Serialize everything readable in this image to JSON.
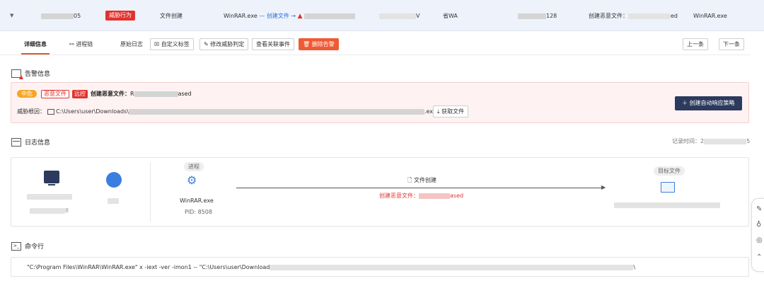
{
  "row": {
    "id_suffix": "05",
    "tag": "威胁行为",
    "event_type": "文件创建",
    "process": "WinRAR.exe",
    "flow_link": "— 创建文件 →",
    "v_suffix": "V",
    "province": "省WA",
    "ip_suffix": "128",
    "created_label": "创建恶意文件：",
    "created_suffix": "ed",
    "process2": "WinRAR.exe"
  },
  "tabs": [
    {
      "label": "详细信息"
    },
    {
      "label": "进程链"
    },
    {
      "label": "原始日志"
    }
  ],
  "buttons": {
    "custom_tag": "自定义标签",
    "modify": "修改威胁判定",
    "related": "查看关联事件",
    "delete": "删除告警",
    "prev": "上一条",
    "next": "下一条"
  },
  "alert_section": {
    "title": "告警信息",
    "level": "中危",
    "type": "恶意文件",
    "remote": "远控",
    "title_prefix": "创建恶意文件：",
    "title_start": "R",
    "title_end": "ased",
    "cause_label": "威胁根因：",
    "path_start": "C:\\Users\\user\\Downloads\\",
    "path_ext": ".exe",
    "fetch": "获取文件",
    "auto_response": "创建自动响应策略"
  },
  "log_section": {
    "title": "日志信息",
    "record_time_label": "记录时间：",
    "record_time_start": "2",
    "record_time_end": "5",
    "host_ip_suffix": "8",
    "process_chip": "进程",
    "process_name": "WinRAR.exe",
    "pid": "PID: 8508",
    "action": "文件创建",
    "action_detail_prefix": "创建恶意文件：",
    "action_detail_end": "ased",
    "target_chip": "目标文件"
  },
  "cmd_section": {
    "title": "命令行",
    "cmd_start": "\"C:\\Program Files\\WinRAR\\WinRAR.exe\" x -iext -ver -imon1 -- \"C:\\Users\\user\\Download",
    "cmd_end": "\\"
  },
  "colors": {
    "accent": "#2b6fd6",
    "danger": "#e0332f",
    "warning": "#f5a623",
    "navy": "#2b3a5d",
    "row_bg": "#eef2fb"
  }
}
